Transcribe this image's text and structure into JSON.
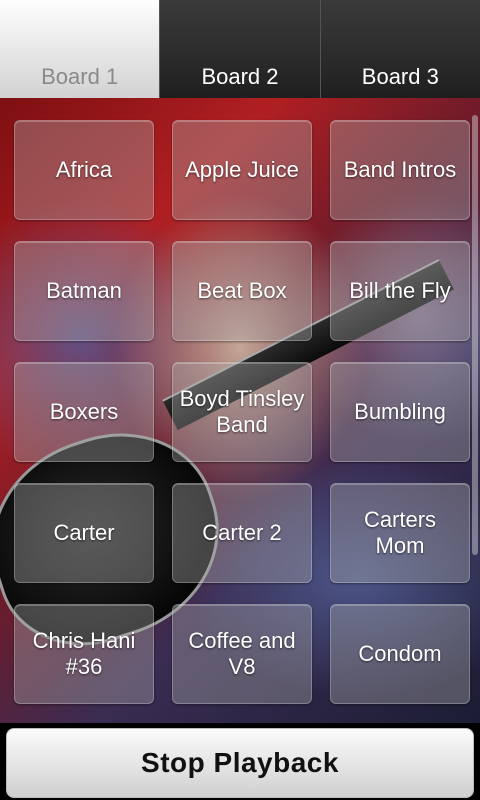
{
  "tabs": [
    {
      "label": "Board 1",
      "active": true
    },
    {
      "label": "Board 2",
      "active": false
    },
    {
      "label": "Board 3",
      "active": false
    }
  ],
  "sound_buttons": [
    "Africa",
    "Apple Juice",
    "Band Intros",
    "Batman",
    "Beat Box",
    "Bill the Fly",
    "Boxers",
    "Boyd Tinsley Band",
    "Bumbling",
    "Carter",
    "Carter 2",
    "Carters Mom",
    "Chris Hani #36",
    "Coffee and V8",
    "Condom"
  ],
  "stop_button": {
    "label": "Stop Playback"
  },
  "colors": {
    "active_tab_text": "#8a8a8a",
    "inactive_tab_text": "#ffffff",
    "button_tint": "#aaaaaa"
  }
}
